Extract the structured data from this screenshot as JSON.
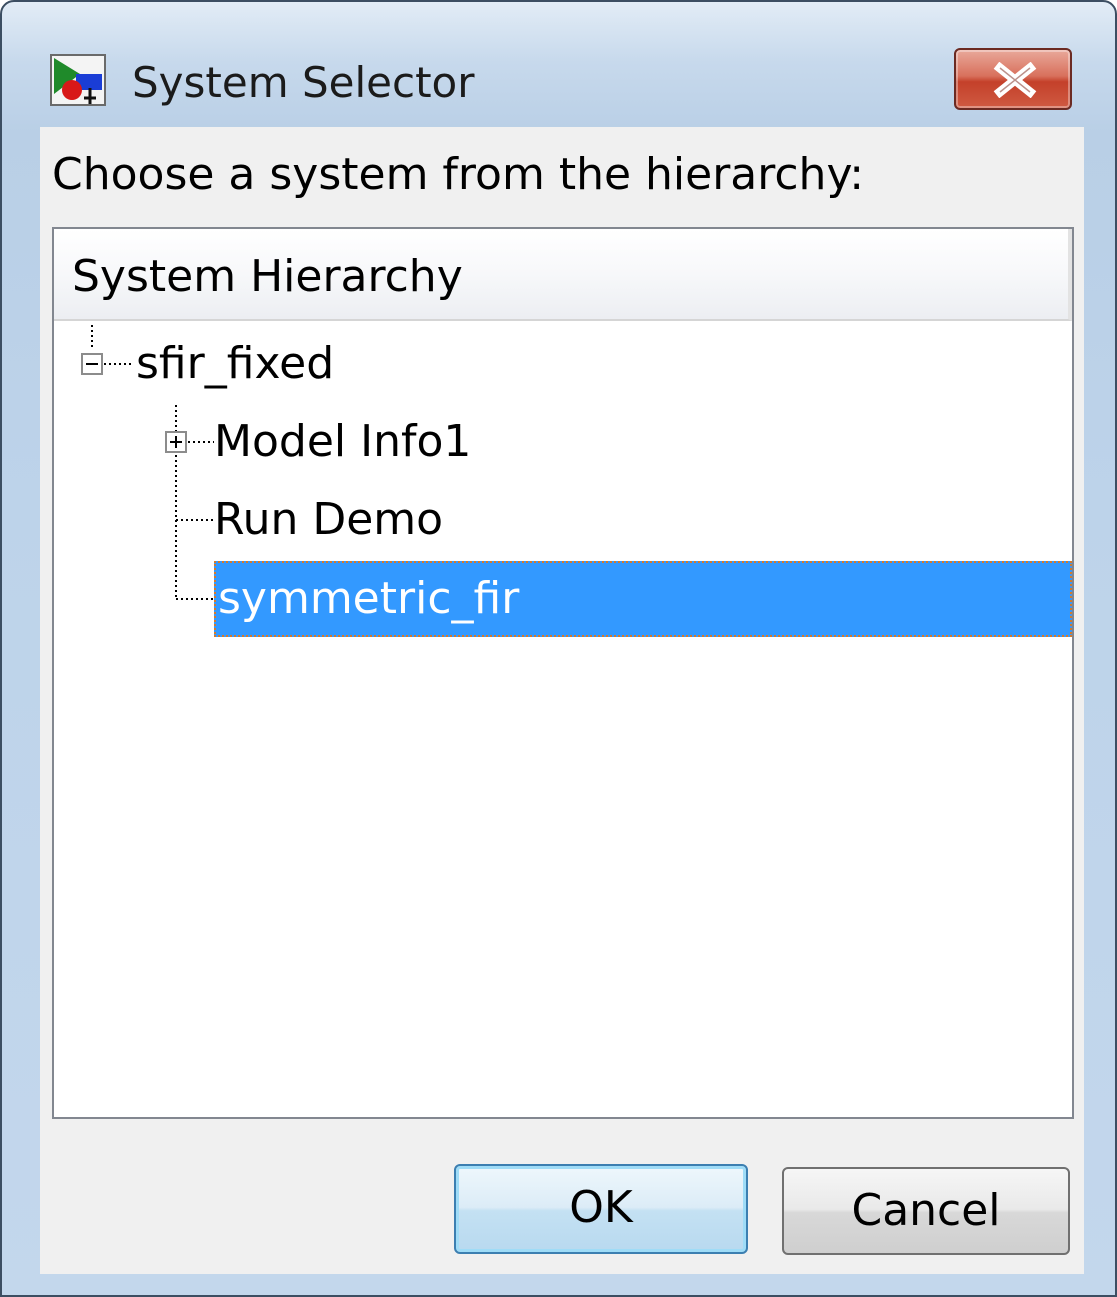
{
  "window": {
    "title": "System Selector",
    "title_icon": "simulink-model-icon",
    "close_icon": "close-icon"
  },
  "prompt": "Choose a system from the hierarchy:",
  "tree": {
    "header": "System Hierarchy",
    "root": {
      "label": "sfir_fixed",
      "expanded": true,
      "children": [
        {
          "label": "Model Info1",
          "expandable": true,
          "expanded": false
        },
        {
          "label": "Run Demo",
          "expandable": false
        },
        {
          "label": "symmetric_fir",
          "expandable": false,
          "selected": true
        }
      ]
    }
  },
  "buttons": {
    "ok": "OK",
    "cancel": "Cancel"
  },
  "colors": {
    "selection": "#3399ff",
    "close_button": "#c4402a",
    "default_button_border": "#3c7fb1"
  }
}
